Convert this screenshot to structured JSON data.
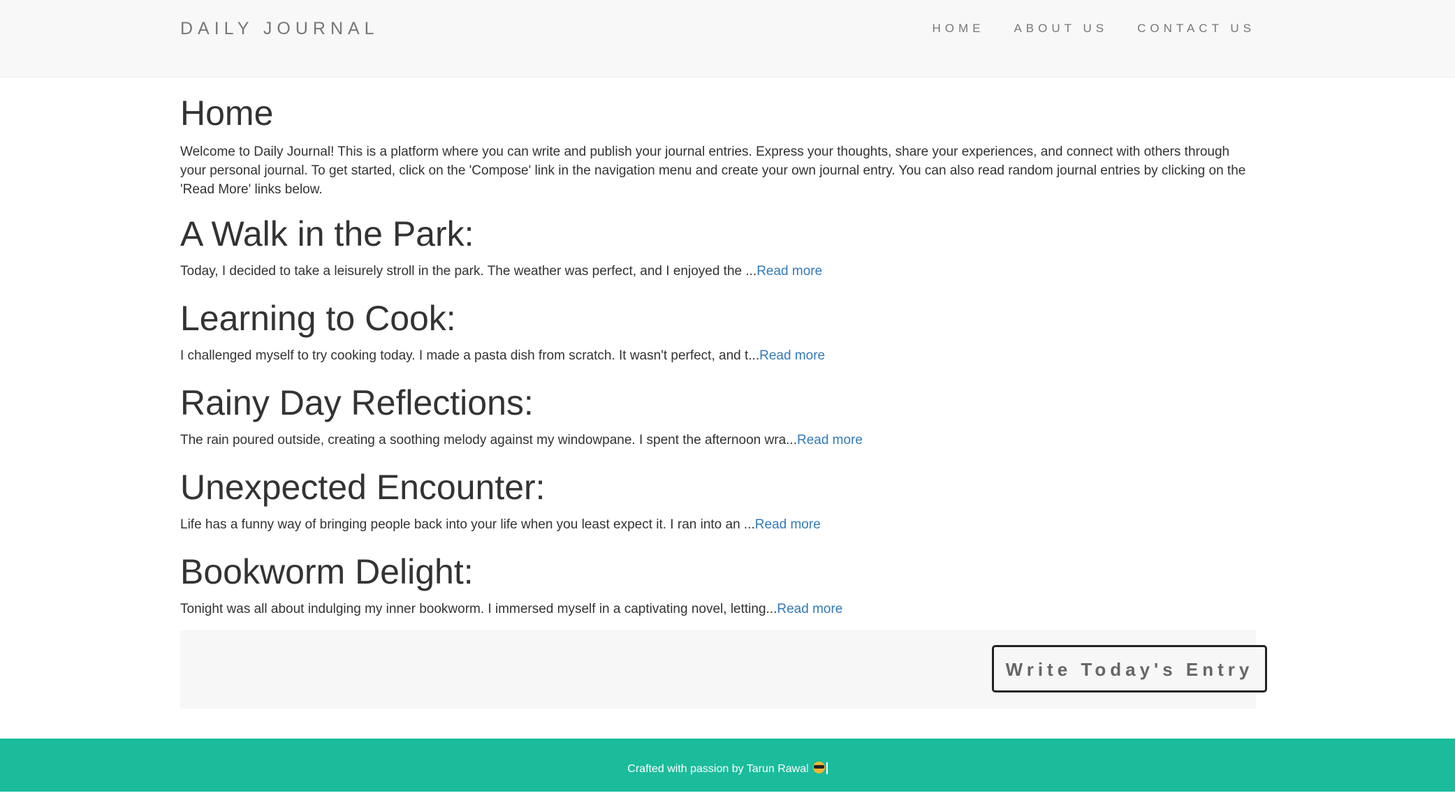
{
  "navbar": {
    "brand": "DAILY JOURNAL",
    "links": [
      "HOME",
      "ABOUT US",
      "CONTACT US"
    ]
  },
  "main": {
    "title": "Home",
    "intro": "Welcome to Daily Journal! This is a platform where you can write and publish your journal entries. Express your thoughts, share your experiences, and connect with others through your personal journal. To get started, click on the 'Compose' link in the navigation menu and create your own journal entry. You can also read random journal entries by clicking on the 'Read More' links below.",
    "posts": [
      {
        "title": "A Walk in the Park:",
        "excerpt": "Today, I decided to take a leisurely stroll in the park. The weather was perfect, and I enjoyed the ...",
        "link": "Read more"
      },
      {
        "title": "Learning to Cook:",
        "excerpt": "I challenged myself to try cooking today. I made a pasta dish from scratch. It wasn't perfect, and t...",
        "link": "Read more"
      },
      {
        "title": "Rainy Day Reflections:",
        "excerpt": "The rain poured outside, creating a soothing melody against my windowpane. I spent the afternoon wra...",
        "link": "Read more"
      },
      {
        "title": "Unexpected Encounter:",
        "excerpt": "Life has a funny way of bringing people back into your life when you least expect it. I ran into an ...",
        "link": "Read more"
      },
      {
        "title": "Bookworm Delight:",
        "excerpt": "Tonight was all about indulging my inner bookworm. I immersed myself in a captivating novel, letting...",
        "link": "Read more"
      }
    ]
  },
  "cta": {
    "label": "Write Today's Entry"
  },
  "footer": {
    "text": "Crafted with passion by Tarun Rawal",
    "emoji_icon": "sunglasses-face-icon"
  },
  "colors": {
    "accent": "#1abc9c",
    "link": "#337ab7",
    "navbar_bg": "#f8f8f8"
  }
}
